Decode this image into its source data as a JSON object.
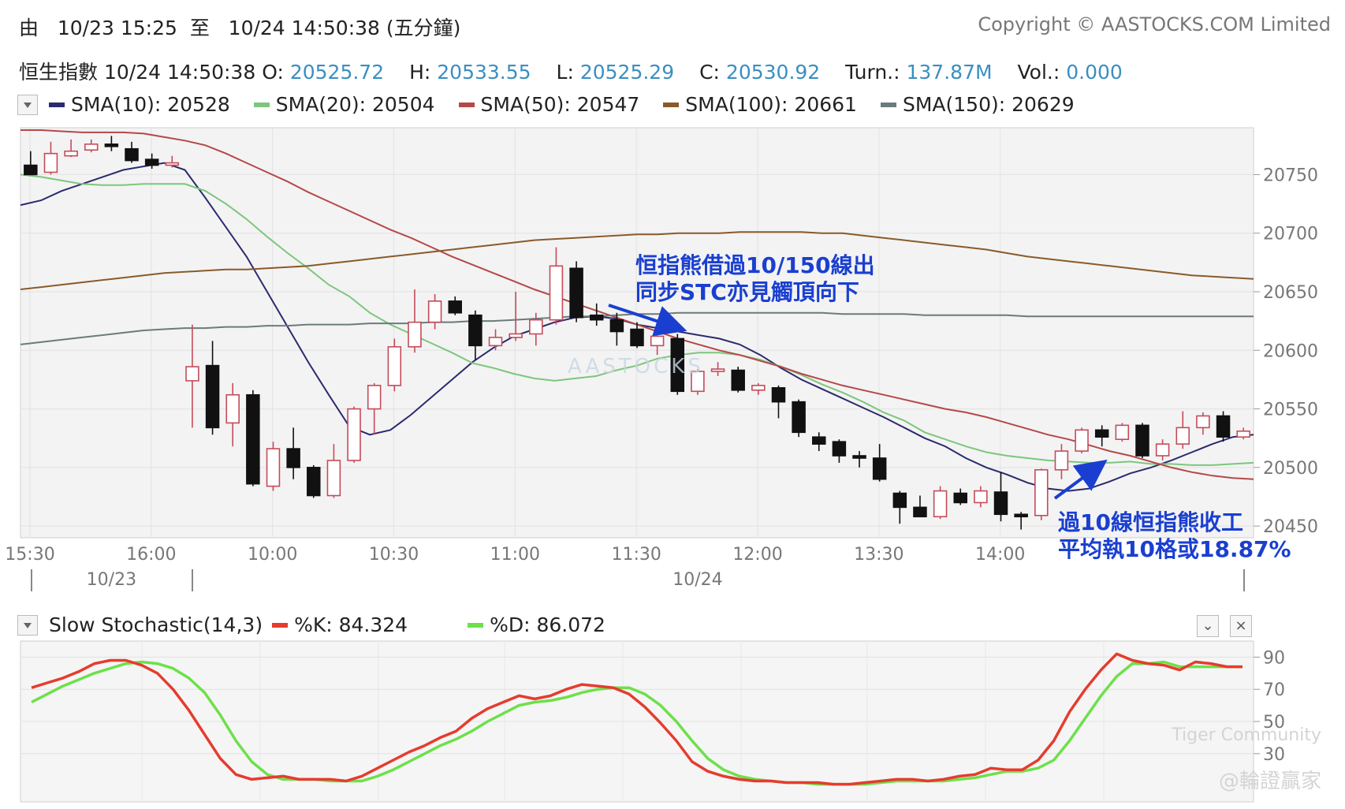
{
  "header": {
    "range_prefix": "由",
    "range_from": "10/23 15:25",
    "range_to_word": "至",
    "range_to": "10/24 14:50:38",
    "range_interval": "(五分鐘)",
    "copyright": "Copyright © AASTOCKS.COM Limited"
  },
  "quote": {
    "name": "恒生指數",
    "time": "10/24 14:50:38",
    "o_label": "O:",
    "o": "20525.72",
    "h_label": "H:",
    "h": "20533.55",
    "l_label": "L:",
    "l": "20525.29",
    "c_label": "C:",
    "c": "20530.92",
    "turn_label": "Turn.:",
    "turn": "137.87M",
    "vol_label": "Vol.:",
    "vol": "0.000"
  },
  "legend": [
    {
      "label": "SMA(10): 20528",
      "color": "#2b2a6e"
    },
    {
      "label": "SMA(20): 20504",
      "color": "#7dc67d"
    },
    {
      "label": "SMA(50): 20547",
      "color": "#b54848"
    },
    {
      "label": "SMA(100): 20661",
      "color": "#8a5a2a"
    },
    {
      "label": "SMA(150): 20629",
      "color": "#6b7b7b"
    }
  ],
  "stoch_legend": {
    "title": "Slow Stochastic(14,3)",
    "k_label": "%K: 84.324",
    "k_color": "#e53c2e",
    "d_label": "%D: 86.072",
    "d_color": "#6de04a"
  },
  "annotations": {
    "top": [
      "恒指熊借過10/150線出",
      "同步STC亦見觸頂向下"
    ],
    "bottom": [
      "過10線恒指熊收工",
      "平均執10格或18.87%"
    ]
  },
  "watermarks": {
    "center": "AASTOCKS",
    "tiger": "Tiger Community",
    "cn": "@輪證贏家"
  },
  "chart_data": [
    {
      "type": "candlestick",
      "ylim": [
        20440,
        20790
      ],
      "yticks": [
        20450,
        20500,
        20550,
        20600,
        20650,
        20700,
        20750
      ],
      "x_tick_labels": [
        "15:30",
        "16:00",
        "10:00",
        "10:30",
        "11:00",
        "11:30",
        "12:00",
        "13:30",
        "14:00"
      ],
      "x_tick_bar_index": [
        0,
        6,
        12,
        18,
        24,
        30,
        36,
        42,
        48
      ],
      "date_labels": [
        "10/23",
        "10/24"
      ],
      "date_label_bar_index": [
        4,
        33
      ],
      "up_color": "#c54b5a",
      "down_color": "#111111",
      "candles": [
        {
          "o": 20758,
          "h": 20770,
          "l": 20750,
          "c": 20750
        },
        {
          "o": 20752,
          "h": 20778,
          "l": 20750,
          "c": 20768
        },
        {
          "o": 20766,
          "h": 20780,
          "l": 20765,
          "c": 20770
        },
        {
          "o": 20771,
          "h": 20780,
          "l": 20769,
          "c": 20776
        },
        {
          "o": 20776,
          "h": 20783,
          "l": 20770,
          "c": 20774
        },
        {
          "o": 20772,
          "h": 20778,
          "l": 20760,
          "c": 20762
        },
        {
          "o": 20763,
          "h": 20768,
          "l": 20755,
          "c": 20758
        },
        {
          "o": 20758,
          "h": 20766,
          "l": 20756,
          "c": 20760
        },
        {
          "o": 20574,
          "h": 20622,
          "l": 20534,
          "c": 20586
        },
        {
          "o": 20587,
          "h": 20608,
          "l": 20528,
          "c": 20534
        },
        {
          "o": 20538,
          "h": 20572,
          "l": 20518,
          "c": 20562
        },
        {
          "o": 20562,
          "h": 20566,
          "l": 20484,
          "c": 20486
        },
        {
          "o": 20484,
          "h": 20522,
          "l": 20480,
          "c": 20516
        },
        {
          "o": 20516,
          "h": 20534,
          "l": 20490,
          "c": 20500
        },
        {
          "o": 20500,
          "h": 20502,
          "l": 20474,
          "c": 20476
        },
        {
          "o": 20476,
          "h": 20520,
          "l": 20474,
          "c": 20506
        },
        {
          "o": 20506,
          "h": 20552,
          "l": 20504,
          "c": 20550
        },
        {
          "o": 20550,
          "h": 20572,
          "l": 20528,
          "c": 20570
        },
        {
          "o": 20570,
          "h": 20610,
          "l": 20565,
          "c": 20603
        },
        {
          "o": 20603,
          "h": 20652,
          "l": 20598,
          "c": 20624
        },
        {
          "o": 20624,
          "h": 20648,
          "l": 20618,
          "c": 20642
        },
        {
          "o": 20642,
          "h": 20646,
          "l": 20630,
          "c": 20632
        },
        {
          "o": 20630,
          "h": 20634,
          "l": 20592,
          "c": 20604
        },
        {
          "o": 20604,
          "h": 20618,
          "l": 20600,
          "c": 20611
        },
        {
          "o": 20611,
          "h": 20650,
          "l": 20608,
          "c": 20614
        },
        {
          "o": 20614,
          "h": 20632,
          "l": 20604,
          "c": 20626
        },
        {
          "o": 20626,
          "h": 20688,
          "l": 20622,
          "c": 20672
        },
        {
          "o": 20670,
          "h": 20676,
          "l": 20624,
          "c": 20628
        },
        {
          "o": 20630,
          "h": 20640,
          "l": 20621,
          "c": 20626
        },
        {
          "o": 20626,
          "h": 20632,
          "l": 20604,
          "c": 20616
        },
        {
          "o": 20618,
          "h": 20624,
          "l": 20602,
          "c": 20604
        },
        {
          "o": 20604,
          "h": 20622,
          "l": 20596,
          "c": 20612
        },
        {
          "o": 20610,
          "h": 20614,
          "l": 20562,
          "c": 20565
        },
        {
          "o": 20565,
          "h": 20584,
          "l": 20562,
          "c": 20582
        },
        {
          "o": 20582,
          "h": 20590,
          "l": 20578,
          "c": 20584
        },
        {
          "o": 20583,
          "h": 20586,
          "l": 20564,
          "c": 20566
        },
        {
          "o": 20566,
          "h": 20572,
          "l": 20562,
          "c": 20570
        },
        {
          "o": 20568,
          "h": 20570,
          "l": 20542,
          "c": 20556
        },
        {
          "o": 20556,
          "h": 20558,
          "l": 20526,
          "c": 20530
        },
        {
          "o": 20526,
          "h": 20530,
          "l": 20514,
          "c": 20520
        },
        {
          "o": 20522,
          "h": 20524,
          "l": 20504,
          "c": 20510
        },
        {
          "o": 20510,
          "h": 20514,
          "l": 20500,
          "c": 20508
        },
        {
          "o": 20508,
          "h": 20520,
          "l": 20488,
          "c": 20490
        },
        {
          "o": 20478,
          "h": 20480,
          "l": 20452,
          "c": 20466
        },
        {
          "o": 20466,
          "h": 20476,
          "l": 20458,
          "c": 20458
        },
        {
          "o": 20458,
          "h": 20484,
          "l": 20456,
          "c": 20480
        },
        {
          "o": 20478,
          "h": 20482,
          "l": 20468,
          "c": 20470
        },
        {
          "o": 20470,
          "h": 20484,
          "l": 20466,
          "c": 20480
        },
        {
          "o": 20479,
          "h": 20496,
          "l": 20454,
          "c": 20460
        },
        {
          "o": 20460,
          "h": 20462,
          "l": 20447,
          "c": 20458
        },
        {
          "o": 20459,
          "h": 20499,
          "l": 20455,
          "c": 20498
        },
        {
          "o": 20498,
          "h": 20520,
          "l": 20490,
          "c": 20514
        },
        {
          "o": 20514,
          "h": 20534,
          "l": 20512,
          "c": 20532
        },
        {
          "o": 20532,
          "h": 20536,
          "l": 20518,
          "c": 20526
        },
        {
          "o": 20524,
          "h": 20538,
          "l": 20522,
          "c": 20536
        },
        {
          "o": 20536,
          "h": 20538,
          "l": 20508,
          "c": 20510
        },
        {
          "o": 20510,
          "h": 20524,
          "l": 20506,
          "c": 20520
        },
        {
          "o": 20520,
          "h": 20548,
          "l": 20516,
          "c": 20534
        },
        {
          "o": 20534,
          "h": 20547,
          "l": 20528,
          "c": 20544
        },
        {
          "o": 20544,
          "h": 20548,
          "l": 20522,
          "c": 20526
        },
        {
          "o": 20526,
          "h": 20534,
          "l": 20524,
          "c": 20531
        }
      ],
      "series": [
        {
          "name": "SMA(10)",
          "color": "#2b2a6e",
          "values": [
            20724,
            20728,
            20736,
            20742,
            20748,
            20754,
            20757,
            20760,
            20754,
            20730,
            20705,
            20680,
            20650,
            20620,
            20590,
            20562,
            20535,
            20528,
            20532,
            20545,
            20560,
            20575,
            20590,
            20602,
            20612,
            20618,
            20624,
            20628,
            20629,
            20627,
            20622,
            20619,
            20616,
            20613,
            20610,
            20605,
            20596,
            20585,
            20575,
            20567,
            20559,
            20551,
            20543,
            20534,
            20525,
            20518,
            20508,
            20500,
            20494,
            20487,
            20482,
            20480,
            20482,
            20488,
            20495,
            20500,
            20506,
            20513,
            20520,
            20526,
            20528
          ]
        },
        {
          "name": "SMA(20)",
          "color": "#7dc67d",
          "values": [
            20750,
            20748,
            20745,
            20742,
            20741,
            20741,
            20742,
            20742,
            20742,
            20736,
            20725,
            20712,
            20697,
            20683,
            20670,
            20656,
            20646,
            20632,
            20622,
            20614,
            20606,
            20598,
            20589,
            20585,
            20580,
            20576,
            20574,
            20576,
            20578,
            20583,
            20587,
            20593,
            20596,
            20598,
            20598,
            20596,
            20592,
            20586,
            20579,
            20571,
            20564,
            20556,
            20547,
            20540,
            20530,
            20524,
            20518,
            20513,
            20510,
            20508,
            20506,
            20505,
            20504,
            20504,
            20505,
            20503,
            20503,
            20502,
            20502,
            20503,
            20504
          ]
        },
        {
          "name": "SMA(50)",
          "color": "#b54848",
          "values": [
            20788,
            20788,
            20787,
            20786,
            20786,
            20786,
            20785,
            20782,
            20779,
            20775,
            20768,
            20760,
            20752,
            20744,
            20735,
            20727,
            20719,
            20711,
            20703,
            20696,
            20688,
            20680,
            20673,
            20666,
            20659,
            20652,
            20646,
            20640,
            20634,
            20628,
            20622,
            20616,
            20610,
            20605,
            20600,
            20596,
            20591,
            20586,
            20580,
            20575,
            20570,
            20566,
            20562,
            20558,
            20554,
            20550,
            20547,
            20543,
            20538,
            20533,
            20528,
            20524,
            20519,
            20514,
            20510,
            20505,
            20500,
            20496,
            20493,
            20491,
            20490
          ]
        },
        {
          "name": "SMA(100)",
          "color": "#8a5a2a",
          "values": [
            20652,
            20654,
            20656,
            20658,
            20660,
            20662,
            20664,
            20666,
            20667,
            20668,
            20669,
            20669,
            20670,
            20671,
            20672,
            20674,
            20676,
            20678,
            20680,
            20682,
            20684,
            20686,
            20688,
            20690,
            20692,
            20694,
            20695,
            20696,
            20697,
            20698,
            20699,
            20699,
            20700,
            20700,
            20700,
            20701,
            20701,
            20701,
            20701,
            20700,
            20700,
            20698,
            20696,
            20694,
            20692,
            20690,
            20688,
            20686,
            20683,
            20680,
            20678,
            20676,
            20674,
            20672,
            20670,
            20668,
            20666,
            20664,
            20663,
            20662,
            20661
          ]
        },
        {
          "name": "SMA(150)",
          "color": "#6b7b7b",
          "values": [
            20605,
            20607,
            20609,
            20611,
            20613,
            20615,
            20617,
            20618,
            20619,
            20619,
            20620,
            20620,
            20621,
            20621,
            20622,
            20622,
            20622,
            20623,
            20623,
            20623,
            20624,
            20624,
            20625,
            20625,
            20626,
            20627,
            20628,
            20629,
            20629,
            20630,
            20631,
            20631,
            20632,
            20632,
            20632,
            20632,
            20632,
            20632,
            20632,
            20632,
            20631,
            20631,
            20631,
            20631,
            20630,
            20630,
            20630,
            20630,
            20630,
            20629,
            20629,
            20629,
            20629,
            20629,
            20629,
            20629,
            20629,
            20629,
            20629,
            20629,
            20629
          ]
        }
      ]
    },
    {
      "type": "line",
      "title": "Slow Stochastic(14,3)",
      "ylim": [
        0,
        100
      ],
      "yticks": [
        30,
        50,
        70,
        90
      ],
      "series": [
        {
          "name": "%K",
          "color": "#e53c2e",
          "values": [
            71,
            74,
            77,
            81,
            86,
            88,
            88,
            85,
            80,
            70,
            57,
            42,
            27,
            17,
            14,
            15,
            16,
            14,
            14,
            14,
            13,
            16,
            21,
            26,
            31,
            35,
            40,
            44,
            52,
            58,
            62,
            66,
            64,
            66,
            70,
            73,
            72,
            71,
            67,
            59,
            49,
            38,
            25,
            19,
            16,
            14,
            13,
            13,
            12,
            12,
            12,
            11,
            11,
            12,
            13,
            14,
            14,
            13,
            14,
            16,
            17,
            21,
            20,
            20,
            26,
            38,
            56,
            70,
            82,
            92,
            88,
            86,
            85,
            82,
            87,
            86,
            84,
            84
          ]
        },
        {
          "name": "%D",
          "color": "#6de04a",
          "values": [
            62,
            67,
            72,
            76,
            80,
            83,
            86,
            87,
            86,
            83,
            77,
            68,
            54,
            38,
            25,
            17,
            14,
            14,
            14,
            13,
            13,
            13,
            16,
            20,
            25,
            30,
            35,
            39,
            44,
            50,
            55,
            60,
            62,
            63,
            65,
            68,
            70,
            71,
            71,
            67,
            60,
            50,
            38,
            27,
            20,
            16,
            14,
            13,
            12,
            12,
            11,
            11,
            11,
            11,
            12,
            13,
            13,
            13,
            13,
            14,
            15,
            17,
            19,
            19,
            21,
            26,
            38,
            52,
            66,
            78,
            86,
            86,
            87,
            84,
            84,
            84,
            84,
            84
          ]
        }
      ]
    }
  ]
}
